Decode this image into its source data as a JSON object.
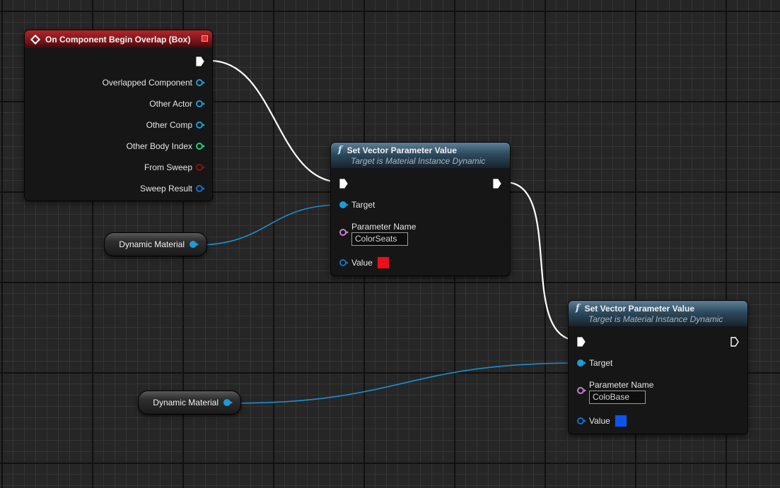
{
  "colors": {
    "exec_wire": "#ffffff",
    "object_pin": "#1e9bd7",
    "int_pin": "#1ed07a",
    "bool_pin": "#8e1010",
    "struct_pin": "#1470c8",
    "name_pin": "#c87dd6",
    "vector_pin": "#1470c8"
  },
  "event_node": {
    "title": "On Component Begin Overlap (Box)",
    "icon": "event-diamond-icon",
    "pins": [
      {
        "label": "Overlapped Component",
        "type": "object"
      },
      {
        "label": "Other Actor",
        "type": "object"
      },
      {
        "label": "Other Comp",
        "type": "object"
      },
      {
        "label": "Other Body Index",
        "type": "int"
      },
      {
        "label": "From Sweep",
        "type": "bool"
      },
      {
        "label": "Sweep Result",
        "type": "struct"
      }
    ]
  },
  "set_vector_1": {
    "title": "Set Vector Parameter Value",
    "subtitle": "Target is Material Instance Dynamic",
    "icon": "function-icon",
    "target_label": "Target",
    "param_name_label": "Parameter Name",
    "param_name_value": "ColorSeats",
    "value_label": "Value",
    "value_color": "#ee0d1b"
  },
  "set_vector_2": {
    "title": "Set Vector Parameter Value",
    "subtitle": "Target is Material Instance Dynamic",
    "icon": "function-icon",
    "target_label": "Target",
    "param_name_label": "Parameter Name",
    "param_name_value": "ColoBase",
    "value_label": "Value",
    "value_color": "#0a55f0"
  },
  "var_node_1": {
    "label": "Dynamic Material"
  },
  "var_node_2": {
    "label": "Dynamic Material"
  }
}
